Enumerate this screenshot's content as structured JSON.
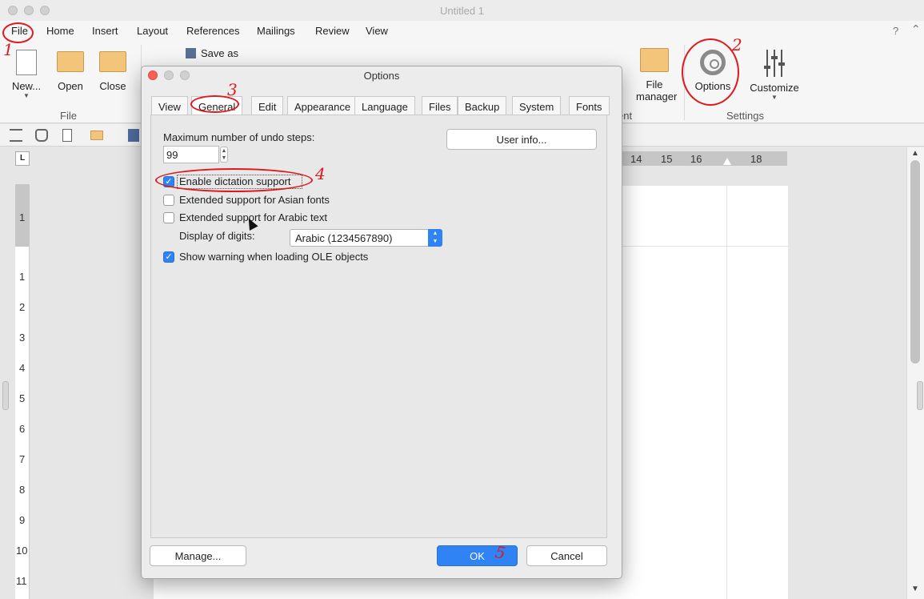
{
  "window": {
    "title": "Untitled 1"
  },
  "menubar": {
    "items": [
      "File",
      "Home",
      "Insert",
      "Layout",
      "References",
      "Mailings",
      "Review",
      "View"
    ],
    "help": "?",
    "collapse": "⌃"
  },
  "ribbon": {
    "new_label": "New...",
    "open_label": "Open",
    "close_label": "Close",
    "save_as_label": "Save as",
    "file_group": "File",
    "file_manager_label": "File\nmanager",
    "partial_group": "ent",
    "options_label": "Options",
    "customize_label": "Customize",
    "settings_group": "Settings"
  },
  "ruler": {
    "h_numbers": [
      "14",
      "15",
      "16",
      "18"
    ],
    "v_numbers": [
      "1",
      "1",
      "2",
      "3",
      "4",
      "5",
      "6",
      "7",
      "8",
      "9",
      "10",
      "11"
    ],
    "corner": "L"
  },
  "dialog": {
    "title": "Options",
    "tabs": [
      "View",
      "General",
      "Edit",
      "Appearance",
      "Language",
      "Files",
      "Backup",
      "System",
      "Fonts"
    ],
    "active_tab": "General",
    "undo_label": "Maximum number of undo steps:",
    "undo_value": "99",
    "user_info_label": "User info...",
    "checkboxes": [
      {
        "label": "Enable dictation support",
        "checked": true
      },
      {
        "label": "Extended support for Asian fonts",
        "checked": false
      },
      {
        "label": "Extended support for Arabic text",
        "checked": false
      },
      {
        "label": "Show warning when loading OLE objects",
        "checked": true
      }
    ],
    "digits_label": "Display of digits:",
    "digits_value": "Arabic (1234567890)",
    "manage_label": "Manage...",
    "ok_label": "OK",
    "cancel_label": "Cancel"
  },
  "annotations": [
    "1",
    "2",
    "3",
    "4",
    "5"
  ],
  "colors": {
    "accent": "#2f83f5",
    "annotation": "#e0191d"
  }
}
